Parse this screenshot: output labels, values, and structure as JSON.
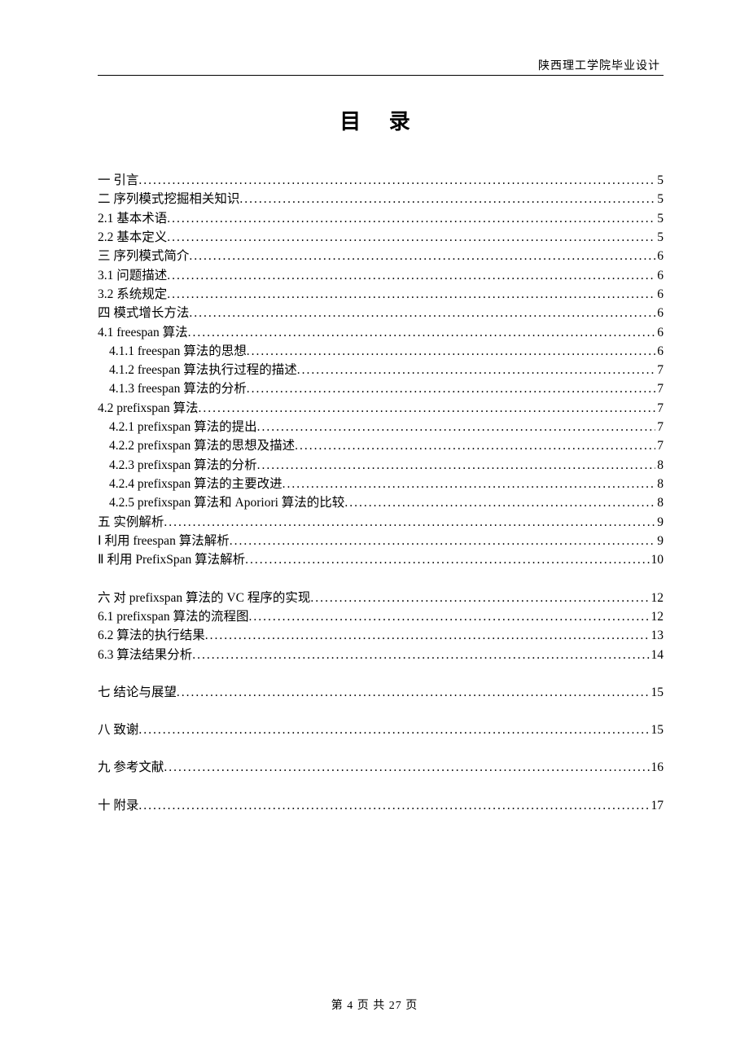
{
  "header": "陕西理工学院毕业设计",
  "title": "目  录",
  "footer": "第 4 页 共 27 页",
  "toc": [
    {
      "label": "一 引言",
      "page": "5",
      "indent": 0,
      "gapBefore": false
    },
    {
      "label": "二 序列模式挖掘相关知识",
      "page": "5",
      "indent": 0,
      "gapBefore": false
    },
    {
      "label": "2.1 基本术语",
      "page": "5",
      "indent": 0,
      "gapBefore": false
    },
    {
      "label": "2.2 基本定义",
      "page": "5",
      "indent": 0,
      "gapBefore": false
    },
    {
      "label": "三 序列模式简介",
      "page": "6",
      "indent": 0,
      "gapBefore": false
    },
    {
      "label": "3.1 问题描述",
      "page": "6",
      "indent": 0,
      "gapBefore": false
    },
    {
      "label": "3.2 系统规定",
      "page": "6",
      "indent": 0,
      "gapBefore": false
    },
    {
      "label": "四 模式增长方法",
      "page": "6",
      "indent": 0,
      "gapBefore": false
    },
    {
      "label": "4.1 freespan 算法 ",
      "page": "6",
      "indent": 0,
      "gapBefore": false
    },
    {
      "label": "4.1.1 freespan 算法的思想 ",
      "page": "6",
      "indent": 1,
      "gapBefore": false
    },
    {
      "label": "4.1.2 freespan 算法执行过程的描述 ",
      "page": "7",
      "indent": 1,
      "gapBefore": false
    },
    {
      "label": "4.1.3 freespan 算法的分析 ",
      "page": "7",
      "indent": 1,
      "gapBefore": false
    },
    {
      "label": "4.2 prefixspan 算法 ",
      "page": "7",
      "indent": 0,
      "gapBefore": false
    },
    {
      "label": "4.2.1 prefixspan 算法的提出 ",
      "page": "7",
      "indent": 1,
      "gapBefore": false
    },
    {
      "label": "4.2.2 prefixspan 算法的思想及描述 ",
      "page": "7",
      "indent": 1,
      "gapBefore": false
    },
    {
      "label": "4.2.3 prefixspan 算法的分析 ",
      "page": "8",
      "indent": 1,
      "gapBefore": false
    },
    {
      "label": "4.2.4 prefixspan 算法的主要改进 ",
      "page": "8",
      "indent": 1,
      "gapBefore": false
    },
    {
      "label": "4.2.5 prefixspan 算法和 Aporiori 算法的比较 ",
      "page": "8",
      "indent": 1,
      "gapBefore": false
    },
    {
      "label": "五 实例解析",
      "page": "9",
      "indent": 0,
      "gapBefore": false
    },
    {
      "label": "Ⅰ 利用 freespan 算法解析",
      "page": "9",
      "indent": 0,
      "gapBefore": false
    },
    {
      "label": "Ⅱ 利用 PrefixSpan 算法解析",
      "page": "10",
      "indent": 0,
      "gapBefore": false
    },
    {
      "label": "六 对 prefixspan 算法的 VC 程序的实现",
      "page": "12",
      "indent": 0,
      "gapBefore": true
    },
    {
      "label": "6.1 prefixspan 算法的流程图 ",
      "page": "12",
      "indent": 0,
      "gapBefore": false
    },
    {
      "label": "6.2 算法的执行结果",
      "page": "13",
      "indent": 0,
      "gapBefore": false
    },
    {
      "label": "6.3 算法结果分析",
      "page": "14",
      "indent": 0,
      "gapBefore": false
    },
    {
      "label": "七 结论与展望",
      "page": "15",
      "indent": 0,
      "gapBefore": true
    },
    {
      "label": "八 致谢",
      "page": "15",
      "indent": 0,
      "gapBefore": true
    },
    {
      "label": "九 参考文献",
      "page": "16",
      "indent": 0,
      "gapBefore": true
    },
    {
      "label": "十 附录",
      "page": "17",
      "indent": 0,
      "gapBefore": true
    }
  ]
}
